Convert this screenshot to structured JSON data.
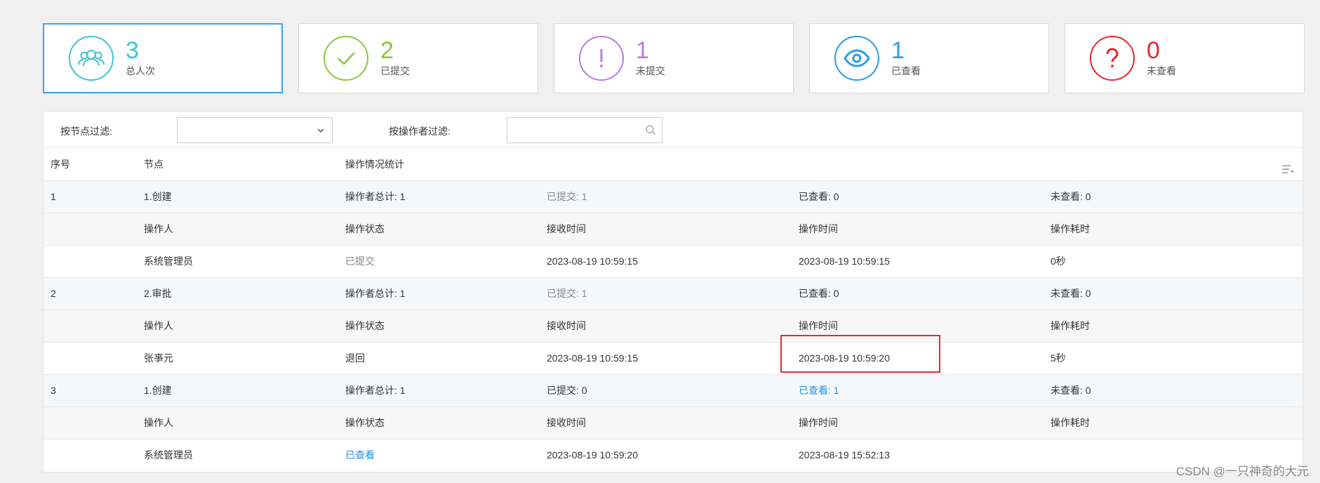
{
  "stats": [
    {
      "value": "3",
      "label": "总人次",
      "color": "#3ec4d0",
      "icon": "users-icon",
      "active": true
    },
    {
      "value": "2",
      "label": "已提交",
      "color": "#8cc63f",
      "icon": "check-icon",
      "active": false
    },
    {
      "value": "1",
      "label": "未提交",
      "color": "#b57ce8",
      "icon": "exclamation-icon",
      "active": false
    },
    {
      "value": "1",
      "label": "已查看",
      "color": "#2a9be6",
      "icon": "eye-icon",
      "active": false
    },
    {
      "value": "0",
      "label": "未查看",
      "color": "#e8262c",
      "icon": "question-icon",
      "active": false
    }
  ],
  "filters": {
    "node_label": "按节点过滤:",
    "node_value": "",
    "operator_label": "按操作者过滤:",
    "operator_placeholder": ""
  },
  "table": {
    "headers": [
      "序号",
      "节点",
      "操作情况统计"
    ],
    "groups": [
      {
        "index": "1",
        "node": "1.创建",
        "total": "操作者总计: 1",
        "submitted": "已提交: 1",
        "viewed": "已查看: 0",
        "unviewed": "未查看: 0",
        "sub_headers": [
          "操作人",
          "操作状态",
          "接收时间",
          "操作时间",
          "操作耗时"
        ],
        "row": [
          "系统管理员",
          "已提交",
          "2023-08-19 10:59:15",
          "2023-08-19 10:59:15",
          "0秒"
        ]
      },
      {
        "index": "2",
        "node": "2.审批",
        "total": "操作者总计: 1",
        "submitted": "已提交: 1",
        "viewed": "已查看: 0",
        "unviewed": "未查看: 0",
        "sub_headers": [
          "操作人",
          "操作状态",
          "接收时间",
          "操作时间",
          "操作耗时"
        ],
        "row": [
          "张亊元",
          "退回",
          "2023-08-19 10:59:15",
          "2023-08-19 10:59:20",
          "5秒"
        ]
      },
      {
        "index": "3",
        "node": "1.创建",
        "total": "操作者总计: 1",
        "submitted": "已提交: 0",
        "viewed": "已查看: 1",
        "unviewed": "未查看: 0",
        "sub_headers": [
          "操作人",
          "操作状态",
          "接收时间",
          "操作时间",
          "操作耗时"
        ],
        "row": [
          "系统管理员",
          "已查看",
          "2023-08-19 10:59:20",
          "2023-08-19 15:52:13",
          ""
        ]
      }
    ]
  },
  "watermark": "CSDN @一只神奇的大元"
}
